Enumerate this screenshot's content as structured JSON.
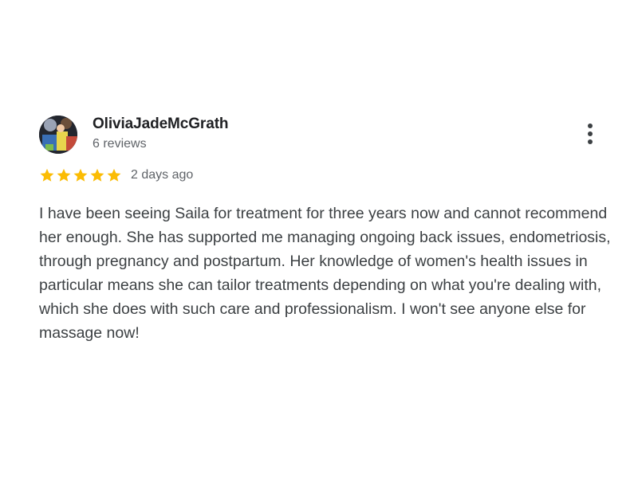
{
  "review": {
    "author": "OliviaJadeMcGrath",
    "review_count": "6 reviews",
    "rating": 5,
    "rating_max": 5,
    "date": "2 days ago",
    "text": "I have been seeing Saila for treatment for three years now and cannot recommend her enough. She has supported me managing ongoing back issues, endometriosis, through pregnancy and postpartum. Her knowledge of women's health issues in particular means she can tailor treatments depending on what you're dealing with, which she does with such care and professionalism. I won't see anyone else for massage now!"
  },
  "icons": {
    "star": "star-icon",
    "more": "more-vert-icon"
  },
  "colors": {
    "star": "#FBBC04",
    "name": "#202124",
    "meta": "#5f6368",
    "body": "#3c4043"
  }
}
